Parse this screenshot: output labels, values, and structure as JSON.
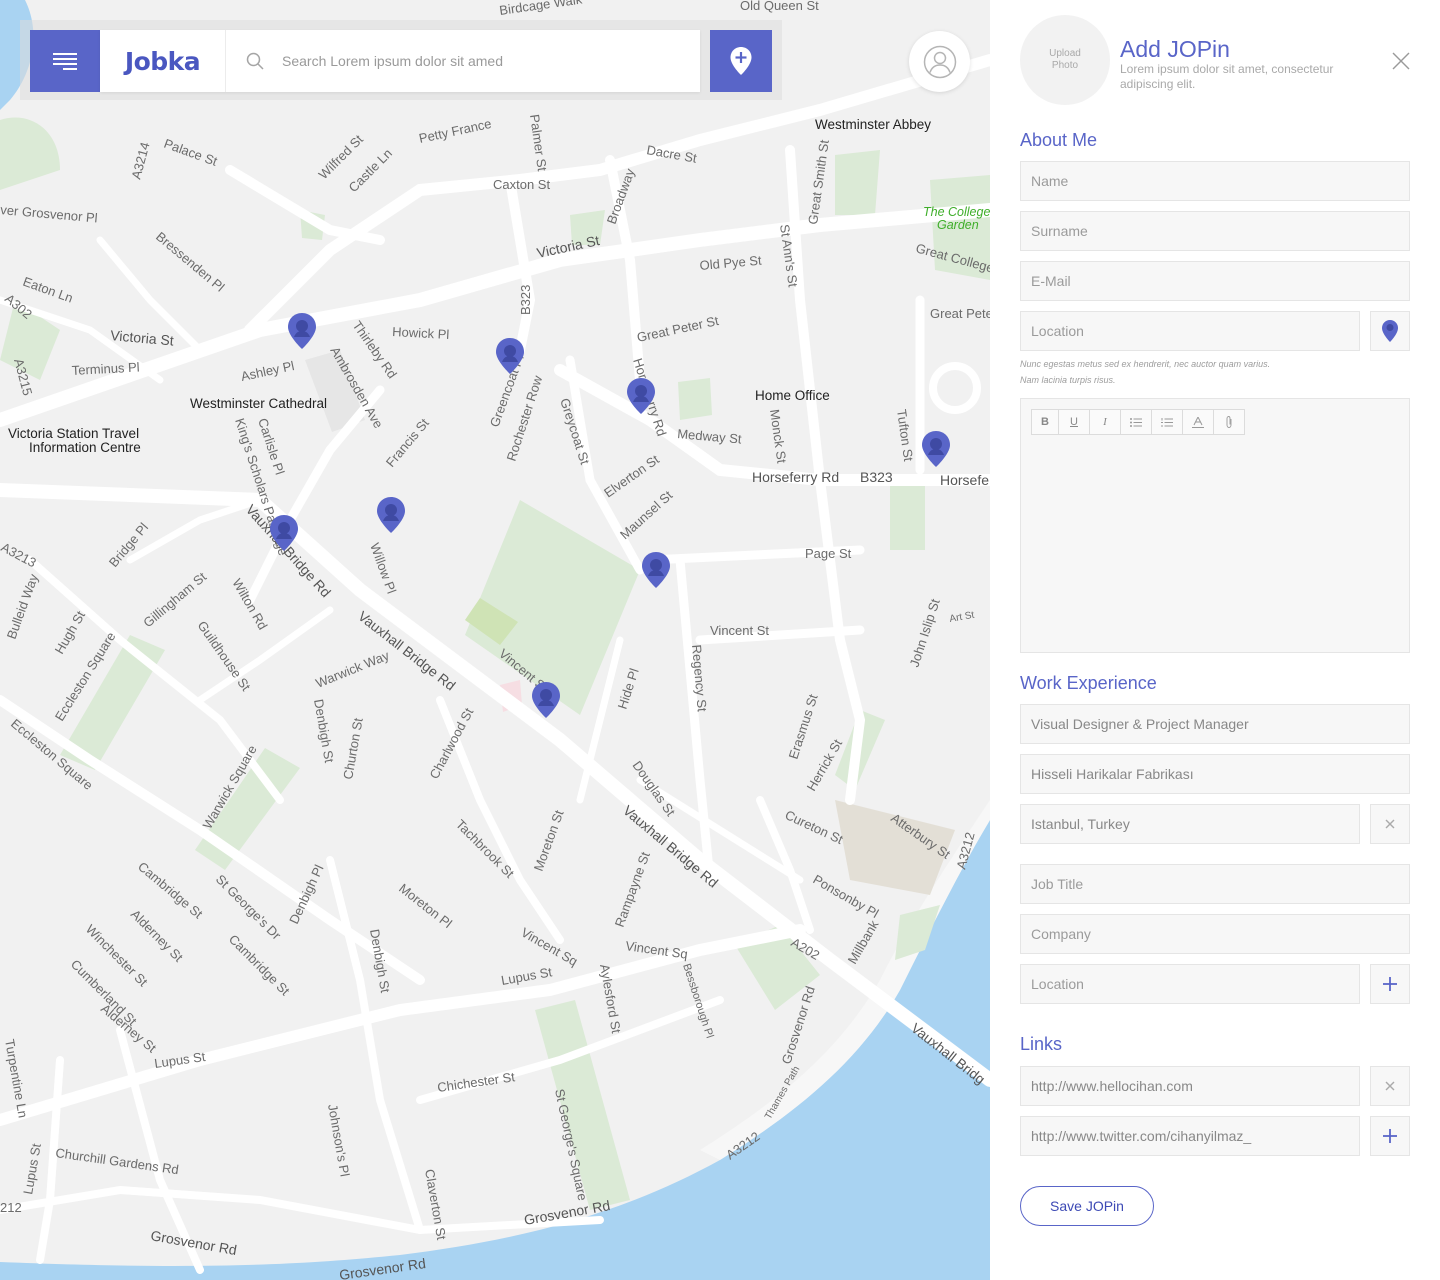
{
  "app": {
    "logo": "Jobka",
    "search_placeholder": "Search Lorem ipsum dolor sit amed",
    "accent_color": "#5965c8"
  },
  "icons": {
    "menu": "hamburger-menu-icon",
    "search": "magnifier-icon",
    "add_pin": "map-pin-plus-icon",
    "user": "user-avatar-icon",
    "close": "x-close-icon"
  },
  "map": {
    "pois": [
      {
        "label": "Westminster Abbey"
      },
      {
        "label": "Westminster Cathedral"
      },
      {
        "label": "Victoria Station Travel"
      },
      {
        "label": "Information Centre"
      },
      {
        "label": "Home Office"
      }
    ],
    "parks": [
      {
        "label": "The College"
      },
      {
        "label": "Garden"
      }
    ],
    "streets": [
      "Birdcage Walk",
      "Old Queen St",
      "Petty France",
      "Palace St",
      "Wilfred St",
      "Castle Ln",
      "Caxton St",
      "Dacre St",
      "Broadway",
      "Palmer St",
      "Great Smith St",
      "Westminster Abbey",
      "ver Grosvenor Pl",
      "Bressenden Pl",
      "A3214",
      "Eaton Ln",
      "A302",
      "Victoria St",
      "Howick Pl",
      "Thirleby Rd",
      "Ambrosden Ave",
      "Ashley Pl",
      "Terminus Pl",
      "A3215",
      "B323",
      "Old Pye St",
      "St Ann's St",
      "Great Peter St",
      "Great College St",
      "Great Peter St",
      "Greencoat Pl",
      "Rochester Row",
      "Greycoat St",
      "Horseferry Rd",
      "Medway St",
      "Monck St",
      "Tufton St",
      "Horseferry Rd",
      "B323",
      "Horsefe",
      "Carlisle Pl",
      "King's Scholars Passage",
      "Francis St",
      "Elverton St",
      "Maunsel St",
      "Vauxhall Bridge Rd",
      "Willow Pl",
      "Page St",
      "A3213",
      "Bridge Pl",
      "Gillingham St",
      "Wilton Rd",
      "Bulleid Way",
      "Hugh St",
      "Guildhouse St",
      "Warwick Way",
      "Vincent St",
      "Vincent Sq",
      "Regency St",
      "Hide Pl",
      "John Islip St",
      "Art St",
      "Eccleston Square",
      "Denbigh St",
      "Churton St",
      "Charlwood St",
      "Douglas St",
      "Erasmus St",
      "Herrick St",
      "Warwick Square",
      "Cureton St",
      "Atterbury St",
      "Ponsonby Pl",
      "Tachbrook St",
      "Moreton St",
      "Cambridge St",
      "St George's Dr",
      "Denbigh Pl",
      "Alderney St",
      "Winchester St",
      "Cumberland St",
      "Moreton Pl",
      "Rampayne St",
      "A202",
      "Millbank",
      "A3212",
      "Lupus St",
      "A3213",
      "Aylesford St",
      "Bessborough Pl",
      "Grosvenor Rd",
      "Chichester St",
      "St George's Square",
      "Turpentine Ln",
      "Churchill Gardens Rd",
      "Johnson's Pl",
      "Claverton St",
      "Thames Path",
      "Grosvenor Rd",
      "Grosvenor Rd",
      "Vauxhall Bridg",
      "A3212",
      "212"
    ],
    "pin_color": "#5965c8"
  },
  "panel": {
    "upload_photo_label": "Upload Photo",
    "title": "Add JOPin",
    "subtitle": "Lorem ipsum dolor sit amet, consectetur adipiscing elit.",
    "about": {
      "title": "About Me",
      "name_placeholder": "Name",
      "surname_placeholder": "Surname",
      "email_placeholder": "E-Mail",
      "location_placeholder": "Location",
      "hint_line1": "Nunc egestas metus sed ex hendrerit, nec auctor quam varius.",
      "hint_line2": "Nam lacinia turpis risus.",
      "toolbar": [
        "B",
        "U",
        "I",
        "bullet-list",
        "numbered-list",
        "text-color",
        "attachment"
      ]
    },
    "work": {
      "title": "Work Experience",
      "entry": {
        "job": "Visual Designer & Project Manager",
        "company": "Hisseli Harikalar Fabrikası",
        "location": "Istanbul, Turkey"
      },
      "job_placeholder": "Job Title",
      "company_placeholder": "Company",
      "location_placeholder": "Location"
    },
    "links": {
      "title": "Links",
      "link1": "http://www.hellocihan.com",
      "link2": "http://www.twitter.com/cihanyilmaz_"
    },
    "save_label": "Save JOPin"
  }
}
